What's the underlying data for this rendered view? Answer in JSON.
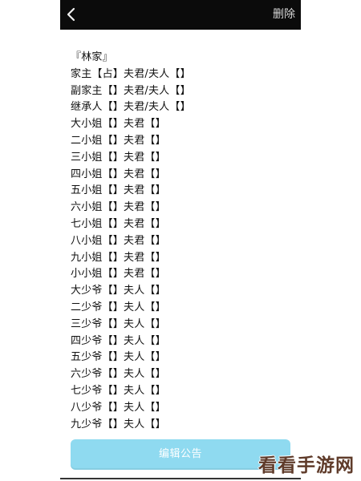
{
  "header": {
    "delete_label": "删除",
    "back_icon": "chevron-left-icon"
  },
  "announcement": {
    "lines": [
      "『林家』",
      "家主【占】夫君/夫人【】",
      "副家主【】夫君/夫人【】",
      "继承人【】夫君/夫人【】",
      "大小姐【】夫君【】",
      "二小姐【】夫君【】",
      "三小姐【】夫君【】",
      "四小姐【】夫君【】",
      "五小姐【】夫君【】",
      "六小姐【】夫君【】",
      "七小姐【】夫君【】",
      "八小姐【】夫君【】",
      "九小姐【】夫君【】",
      "小小姐【】夫君【】",
      "大少爷【】夫人【】",
      "二少爷【】夫人【】",
      "三少爷【】夫人【】",
      "四少爷【】夫人【】",
      "五少爷【】夫人【】",
      "六少爷【】夫人【】",
      "七少爷【】夫人【】",
      "八少爷【】夫人【】",
      "九少爷【】夫人【】"
    ]
  },
  "footer": {
    "edit_label": "编辑公告"
  },
  "watermark": {
    "text": "看看手游网"
  },
  "colors": {
    "topbar": "#0b0b0b",
    "button": "#8fdaf0"
  }
}
